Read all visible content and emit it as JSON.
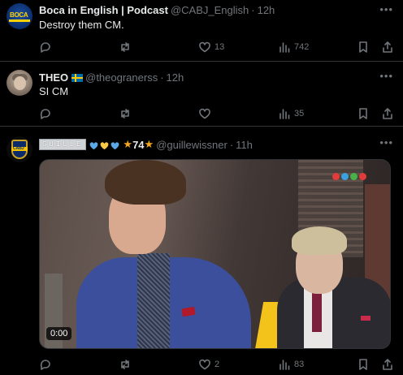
{
  "tweets": [
    {
      "display_name": "Boca in English | Podcast",
      "handle": "@CABJ_English",
      "time": "12h",
      "text": "Destroy them CM.",
      "avatar_text": "BOCA",
      "counts": {
        "replies": "",
        "reposts": "",
        "likes": "13",
        "views": "742"
      }
    },
    {
      "display_name": "THEO",
      "handle": "@theogranerss",
      "time": "12h",
      "text": "SI CM",
      "counts": {
        "replies": "",
        "reposts": "",
        "likes": "",
        "views": "35"
      }
    },
    {
      "display_name_styled": "GUILLE",
      "number": "74",
      "handle": "@guillewissner",
      "time": "11h",
      "avatar_text": "CABJ",
      "video": {
        "timestamp": "0:00"
      },
      "counts": {
        "replies": "",
        "reposts": "",
        "likes": "2",
        "views": "83"
      }
    }
  ],
  "separator": "·",
  "more_icon": "more-horizontal-icon",
  "colors": {
    "background": "#000000",
    "text": "#e7e9ea",
    "muted": "#71767b",
    "border": "#2f3336"
  }
}
